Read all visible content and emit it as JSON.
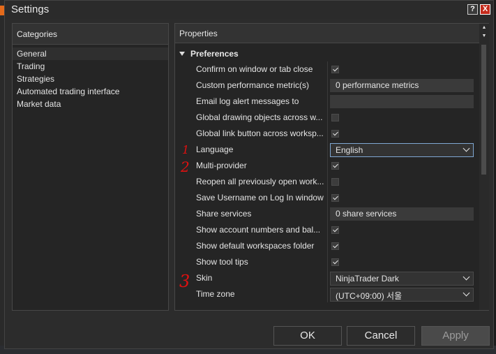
{
  "window": {
    "title": "Settings",
    "help_label": "?",
    "close_label": "X"
  },
  "categories": {
    "header": "Categories",
    "items": [
      {
        "label": "General",
        "selected": true
      },
      {
        "label": "Trading"
      },
      {
        "label": "Strategies"
      },
      {
        "label": "Automated trading interface"
      },
      {
        "label": "Market data"
      }
    ]
  },
  "properties": {
    "header": "Properties",
    "section": "Preferences",
    "rows": [
      {
        "name": "Confirm on window or tab close",
        "type": "check",
        "checked": true
      },
      {
        "name": "Custom performance metric(s)",
        "type": "field",
        "value": "0 performance metrics"
      },
      {
        "name": "Email log alert messages to",
        "type": "field",
        "value": ""
      },
      {
        "name": "Global drawing objects across w...",
        "type": "check",
        "checked": false
      },
      {
        "name": "Global link button across worksp...",
        "type": "check",
        "checked": true
      },
      {
        "name": "Language",
        "type": "select",
        "value": "English",
        "focus": true
      },
      {
        "name": "Multi-provider",
        "type": "check",
        "checked": true
      },
      {
        "name": "Reopen all previously open work...",
        "type": "check",
        "checked": false
      },
      {
        "name": "Save Username on Log In window",
        "type": "check",
        "checked": true
      },
      {
        "name": "Share services",
        "type": "field",
        "value": "0 share services"
      },
      {
        "name": "Show account numbers and bal...",
        "type": "check",
        "checked": true
      },
      {
        "name": "Show default workspaces folder",
        "type": "check",
        "checked": true
      },
      {
        "name": "Show tool tips",
        "type": "check",
        "checked": true
      },
      {
        "name": "Skin",
        "type": "select",
        "value": "NinjaTrader Dark"
      },
      {
        "name": "Time zone",
        "type": "select",
        "value": "(UTC+09:00) 서울"
      }
    ]
  },
  "annotations": [
    "1",
    "2",
    "3"
  ],
  "buttons": {
    "ok": "OK",
    "cancel": "Cancel",
    "apply": "Apply"
  },
  "colors": {
    "annotation": "#e01010",
    "close": "#c42b1c",
    "focus_border": "#7fa7d3"
  }
}
